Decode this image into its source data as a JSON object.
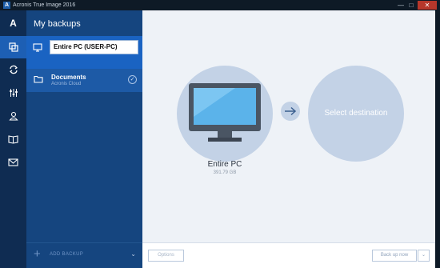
{
  "window": {
    "title": "Acronis True Image 2016",
    "app_icon_letter": "A",
    "minimize_glyph": "—",
    "maximize_glyph": "□",
    "close_glyph": "✕"
  },
  "rail": {
    "logo_letter": "A",
    "items": [
      {
        "icon": "backup-copies-icon"
      },
      {
        "icon": "sync-icon"
      },
      {
        "icon": "tools-icon"
      },
      {
        "icon": "account-icon"
      },
      {
        "icon": "help-book-icon"
      },
      {
        "icon": "mail-icon"
      }
    ]
  },
  "panel": {
    "heading": "My backups",
    "selected_backup": {
      "name": "Entire PC (USER-PC)",
      "icon": "computer-icon"
    },
    "backups": [
      {
        "label": "Documents",
        "destination": "Acronis Cloud",
        "icon": "folder-icon",
        "status_glyph": "✓"
      }
    ],
    "add_backup": {
      "plus": "+",
      "label": "ADD BACKUP",
      "chevron": "⌄"
    }
  },
  "main": {
    "source": {
      "label": "Entire PC",
      "size": "391.79 GB"
    },
    "arrow_icon": "arrow-right-icon",
    "destination_placeholder": "Select destination",
    "options_button": "Options",
    "backup_button": "Back up now",
    "dropdown_glyph": "⌄"
  },
  "colors": {
    "rail": "#0f2c52",
    "panel": "#15457f",
    "selected_row": "#1a63c2",
    "circle": "#c3d2e6",
    "main_bg": "#eef2f7"
  }
}
